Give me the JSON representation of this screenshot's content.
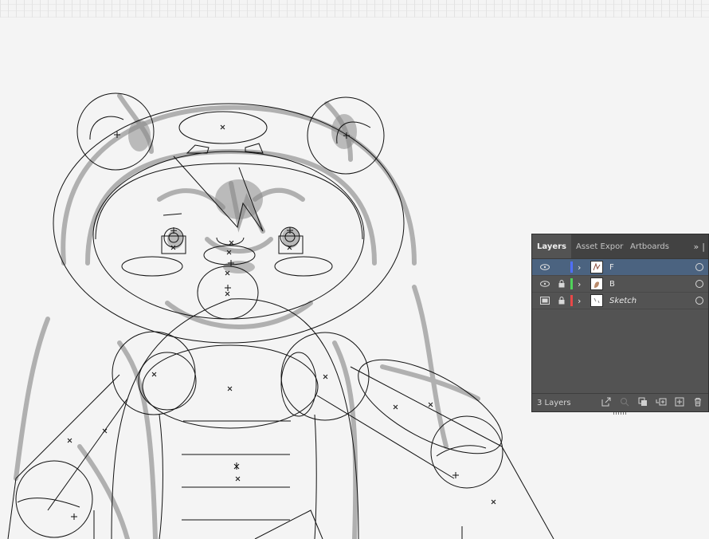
{
  "layers_panel": {
    "tabs": [
      {
        "label": "Layers"
      },
      {
        "label": "Asset Expor"
      },
      {
        "label": "Artboards"
      }
    ],
    "more_label": "»",
    "layers": [
      {
        "name": "F",
        "color": "#4f6fff",
        "visible": true,
        "locked": false,
        "selected": true
      },
      {
        "name": "B",
        "color": "#4fd35a",
        "visible": true,
        "locked": true,
        "selected": false
      },
      {
        "name": "Sketch",
        "color": "#e84848",
        "visible": "template",
        "locked": true,
        "selected": false
      }
    ],
    "footer": {
      "count_label": "3 Layers",
      "icons": [
        "export-icon",
        "locate-object-icon",
        "clipping-mask-icon",
        "new-sublayer-icon",
        "new-layer-icon",
        "trash-icon"
      ]
    }
  }
}
